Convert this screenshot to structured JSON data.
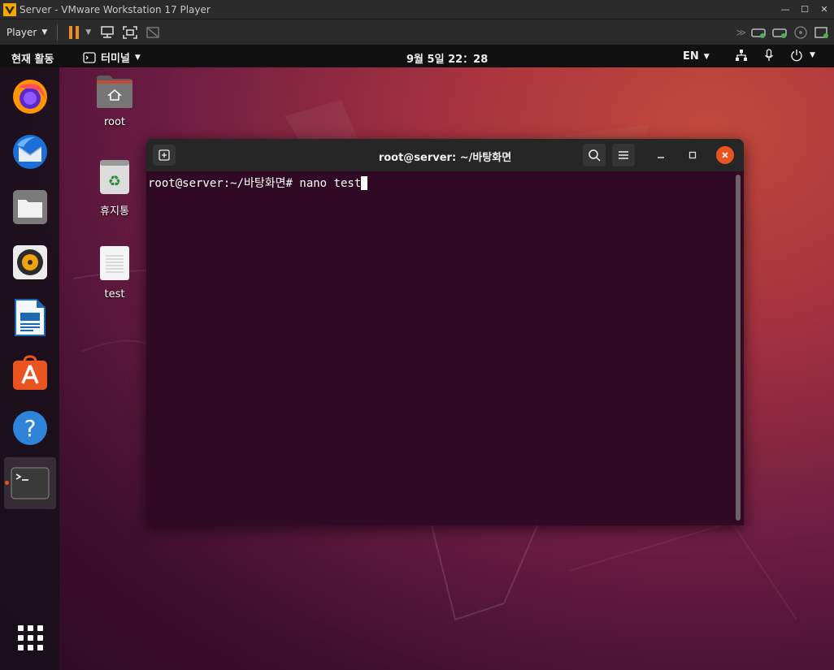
{
  "vm": {
    "title": "Server - VMware Workstation 17 Player",
    "player_label": "Player",
    "accent": "#f28c28"
  },
  "topbar": {
    "activities": "현재 활동",
    "app_menu": "터미널",
    "clock": "9월 5일  22：28",
    "lang": "EN"
  },
  "dock": {
    "items": [
      {
        "name": "Firefox",
        "icon": "firefox-icon"
      },
      {
        "name": "Thunderbird",
        "icon": "thunderbird-icon"
      },
      {
        "name": "Files",
        "icon": "files-icon"
      },
      {
        "name": "Rhythmbox",
        "icon": "rhythmbox-icon"
      },
      {
        "name": "LibreOffice Writer",
        "icon": "writer-icon"
      },
      {
        "name": "Ubuntu Software",
        "icon": "software-icon"
      },
      {
        "name": "Help",
        "icon": "help-icon"
      },
      {
        "name": "Terminal",
        "icon": "terminal-icon",
        "active": true
      }
    ]
  },
  "desktop": {
    "icons": [
      {
        "label": "root",
        "icon": "home-folder-icon"
      },
      {
        "label": "휴지통",
        "icon": "trash-icon"
      },
      {
        "label": "test",
        "icon": "text-file-icon"
      }
    ]
  },
  "terminal": {
    "title": "root@server: ~/바탕화면",
    "prompt": "root@server:~/바탕화면# ",
    "command": "nano test",
    "bg_color": "#300a24"
  }
}
